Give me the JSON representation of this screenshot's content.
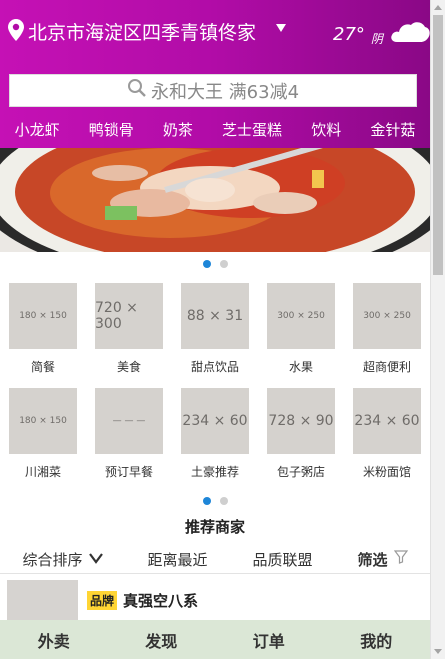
{
  "header": {
    "location": "北京市海淀区四季青镇佟家",
    "temperature": "27°",
    "condition": "阴",
    "icons": {
      "location": "map-pin-icon",
      "dropdown": "caret-down-icon",
      "weather": "cloud-icon",
      "search": "search-icon"
    }
  },
  "search": {
    "placeholder": "永和大王 满63减4"
  },
  "categories": [
    "小龙虾",
    "鸭锁骨",
    "奶茶",
    "芝士蛋糕",
    "饮料",
    "金针菇"
  ],
  "grid": {
    "row1": [
      {
        "thumb": "180 × 150",
        "label": "简餐"
      },
      {
        "thumb": "720 × 300",
        "label": "美食"
      },
      {
        "thumb": "88 × 31",
        "label": "甜点饮品"
      },
      {
        "thumb": "300 × 250",
        "label": "水果"
      },
      {
        "thumb": "300 × 250",
        "label": "超商便利"
      }
    ],
    "row2": [
      {
        "thumb": "180 × 150",
        "label": "川湘菜"
      },
      {
        "thumb": "— — —",
        "label": "预订早餐"
      },
      {
        "thumb": "234 × 60",
        "label": "土豪推荐"
      },
      {
        "thumb": "728 × 90",
        "label": "包子粥店"
      },
      {
        "thumb": "234 × 60",
        "label": "米粉面馆"
      }
    ]
  },
  "section": {
    "title": "推荐商家"
  },
  "sort": {
    "comprehensive": "综合排序",
    "distance": "距离最近",
    "quality": "品质联盟",
    "filter": "筛选"
  },
  "merchant": {
    "badge": "品牌",
    "name": "真强空八系"
  },
  "tabs": [
    "外卖",
    "发现",
    "订单",
    "我的"
  ],
  "colors": {
    "header_start": "#c511b5",
    "header_end": "#8a0886",
    "dot_active": "#1e86d8",
    "tabbar_bg": "#dbe7d6",
    "badge_bg": "#ffd534"
  }
}
